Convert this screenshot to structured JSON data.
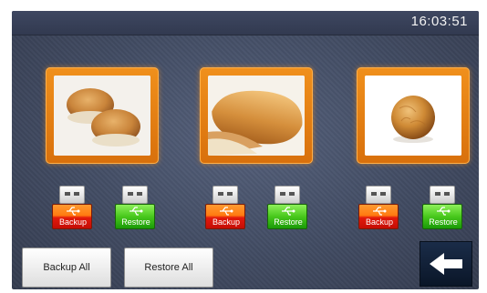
{
  "header": {
    "clock": "16:03:51"
  },
  "products": [
    {
      "name": "burger-buns",
      "backup_label": "Backup",
      "restore_label": "Restore"
    },
    {
      "name": "hot-dog-bun",
      "backup_label": "Backup",
      "restore_label": "Restore"
    },
    {
      "name": "round-roll",
      "backup_label": "Backup",
      "restore_label": "Restore"
    }
  ],
  "footer": {
    "backup_all_label": "Backup All",
    "restore_all_label": "Restore All",
    "back_icon": "arrow-left-icon"
  },
  "colors": {
    "tile_orange": "#e07a14",
    "backup_red": "#d8180c",
    "restore_green": "#2fb012",
    "background": "#424c63"
  }
}
